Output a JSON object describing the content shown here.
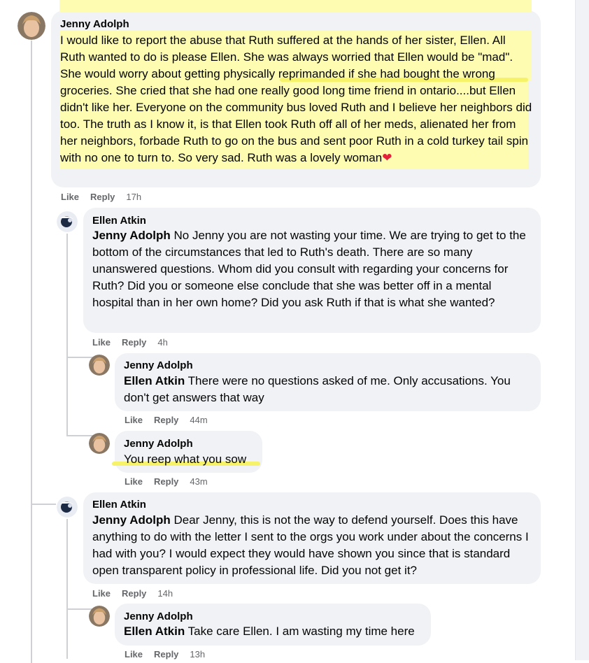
{
  "comments": [
    {
      "author": "Jenny Adolph",
      "mention": "",
      "text": "I would like to report the abuse that Ruth suffered at the hands of her sister, Ellen. All Ruth wanted to do is please Ellen. She was always worried that Ellen would be \"mad\". She would worry about getting physically reprimanded if she had bought the wrong groceries. She cried that she had one really good long time friend in ontario....but Ellen didn't like her. Everyone on the community bus loved Ruth and I believe her neighbors did too. The truth as I know it, is that Ellen took Ruth off all of her meds, alienated her from her neighbors, forbade Ruth to go on the bus and sent poor Ruth in a cold turkey tail spin with no one to turn to. So very sad. Ruth was a lovely woman",
      "emoji": "❤️",
      "like": "Like",
      "reply": "Reply",
      "time": "17h"
    },
    {
      "author": "Ellen Atkin",
      "mention": "Jenny Adolph",
      "text": "No Jenny you are not wasting your time. We are trying to get to the bottom of the circumstances that led to Ruth's death. There are so many unanswered questions. Whom did you consult with regarding your concerns for Ruth? Did you or someone else conclude that she was better off in a mental hospital than in her own home? Did you ask Ruth if that is what she wanted?",
      "like": "Like",
      "reply": "Reply",
      "time": "4h"
    },
    {
      "author": "Jenny Adolph",
      "mention": "Ellen Atkin",
      "text": "There were no questions asked of me. Only accusations. You don't get answers that way",
      "like": "Like",
      "reply": "Reply",
      "time": "44m"
    },
    {
      "author": "Jenny Adolph",
      "mention": "",
      "text": "You reep what you sow",
      "like": "Like",
      "reply": "Reply",
      "time": "43m"
    },
    {
      "author": "Ellen Atkin",
      "mention": "Jenny Adolph",
      "text": "Dear Jenny, this is not the way to defend yourself. Does this have anything to do with the letter I sent to the orgs you work under about the concerns I had with you? I would expect they would have shown you since that is standard open transparent policy in professional life. Did you not get it?",
      "like": "Like",
      "reply": "Reply",
      "time": "14h"
    },
    {
      "author": "Jenny Adolph",
      "mention": "Ellen Atkin",
      "text": "Take care Ellen. I am wasting my time here",
      "like": "Like",
      "reply": "Reply",
      "time": "13h"
    }
  ],
  "highlight_color": "#fdfcb0"
}
